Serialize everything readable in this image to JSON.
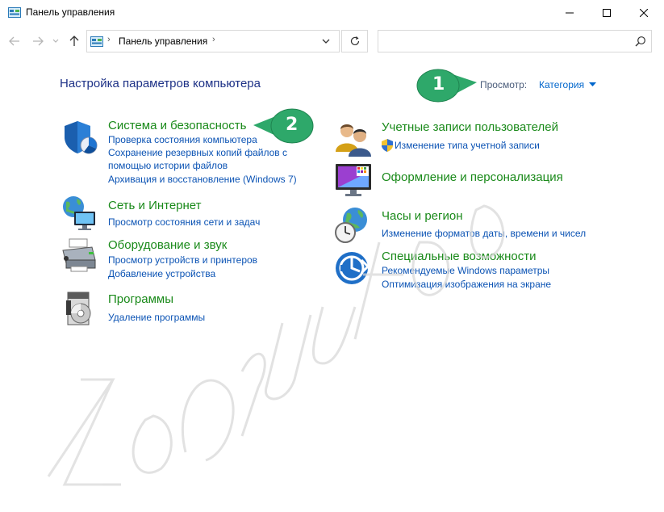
{
  "window": {
    "title": "Панель управления"
  },
  "address": {
    "crumb": "Панель управления",
    "search_placeholder": ""
  },
  "main": {
    "page_title": "Настройка параметров компьютера",
    "view_label": "Просмотр:",
    "view_value": "Категория"
  },
  "categories": [
    {
      "title": "Система и безопасность",
      "icon": "shield-icon",
      "links": [
        "Проверка состояния компьютера",
        "Сохранение резервных копий файлов с",
        "помощью истории файлов",
        "Архивация и восстановление (Windows 7)"
      ]
    },
    {
      "title": "Сеть и Интернет",
      "icon": "network-globe-icon",
      "links": [
        "Просмотр состояния сети и задач"
      ]
    },
    {
      "title": "Оборудование и звук",
      "icon": "printer-icon",
      "links": [
        "Просмотр устройств и принтеров",
        "Добавление устройства"
      ]
    },
    {
      "title": "Программы",
      "icon": "programs-icon",
      "links": [
        "Удаление программы"
      ]
    },
    {
      "title": "Учетные записи пользователей",
      "icon": "users-icon",
      "links": [
        "Изменение типа учетной записи"
      ]
    },
    {
      "title": "Оформление и персонализация",
      "icon": "display-palette-icon",
      "links": []
    },
    {
      "title": "Часы и регион",
      "icon": "clock-globe-icon",
      "links": [
        "Изменение форматов даты, времени и чисел"
      ]
    },
    {
      "title": "Специальные возможности",
      "icon": "accessibility-icon",
      "links": [
        "Рекомендуемые Windows параметры",
        "Оптимизация изображения на экране"
      ]
    }
  ],
  "callouts": [
    {
      "number": "1"
    },
    {
      "number": "2"
    }
  ],
  "colors": {
    "title_green": "#1a8a1a",
    "link_blue": "#0b53b4",
    "heading_blue": "#1e3287",
    "callout_green": "#2ea86a"
  }
}
